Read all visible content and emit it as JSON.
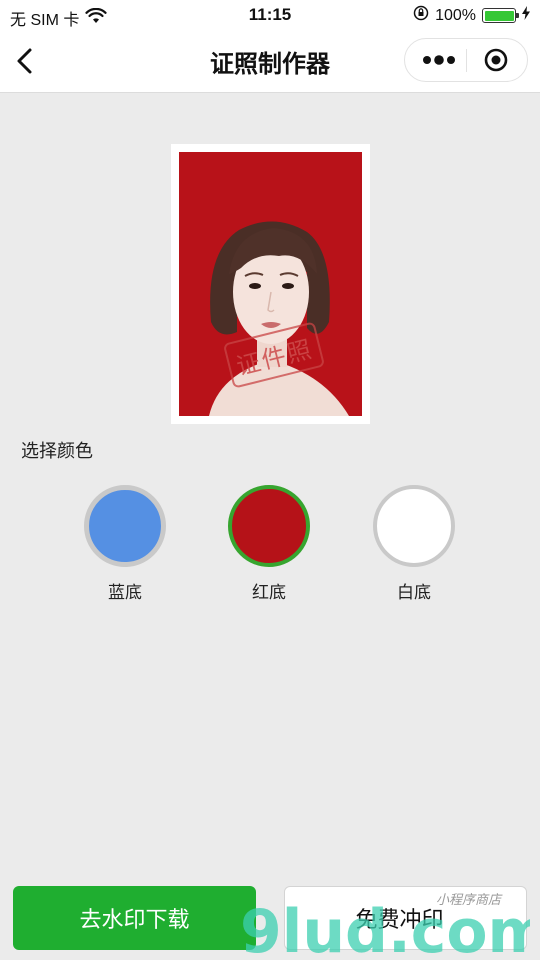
{
  "status_bar": {
    "carrier": "无 SIM 卡",
    "time": "11:15",
    "battery_percent": "100%",
    "battery_level": 1.0
  },
  "nav": {
    "title": "证照制作器"
  },
  "photo": {
    "watermark_stamp": "证件照",
    "background_color": "#b81219"
  },
  "color_picker": {
    "label": "选择颜色",
    "options": [
      {
        "label": "蓝底",
        "color": "#5590e3",
        "selected": false
      },
      {
        "label": "红底",
        "color": "#b51218",
        "selected": true
      },
      {
        "label": "白底",
        "color": "#ffffff",
        "selected": false
      }
    ]
  },
  "actions": {
    "primary": "去水印下载",
    "secondary": "免费冲印"
  },
  "site_watermark": {
    "logo_text": "9lud.com",
    "tagline": "小程序商店"
  },
  "colors": {
    "accent_green": "#1fae30",
    "selected_ring": "#37a52f"
  }
}
